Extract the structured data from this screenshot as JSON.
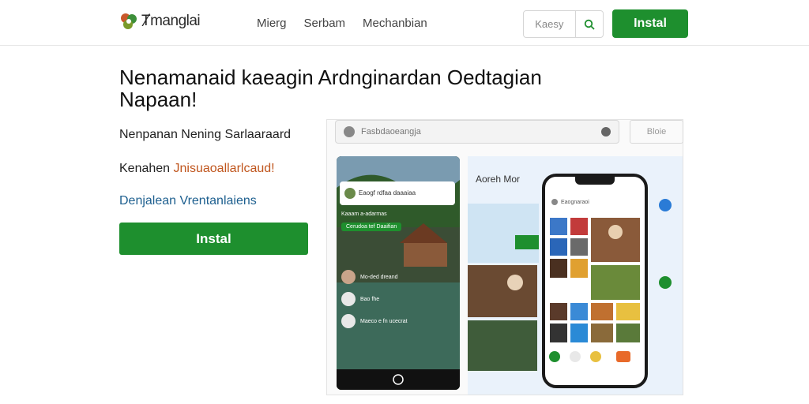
{
  "header": {
    "brand": "Ⱦmanglai",
    "nav": [
      "Mierg",
      "Serbam",
      "Mechanbian"
    ],
    "search_placeholder": "Kaesy",
    "install_label": "Instal"
  },
  "hero": {
    "headline": "Nenamanaid kaeagin Ardnginardan Oedtagian Napaan!",
    "features": {
      "f1": "Nenpanan Nening Sarlaaraard",
      "f2_prefix": "Kenahen ",
      "f2_highlight": "Jnisuaoallarlcaud!",
      "f3": "Denjalean Vrentanlaiens"
    },
    "install_label": "Instal"
  },
  "preview": {
    "search_text": "Fasbdaoeangja",
    "button_label": "Bloie",
    "phone1": {
      "card_title": "Eaogf rdfaa daaaiaa",
      "tag": "Kaaam a-adarmas",
      "pill": "Cerudoa tef Daaifian",
      "item1": "Mo-ded dreand",
      "item2": "Bao fhe",
      "item3": "Maeco e fn ucecrat"
    },
    "panel2": {
      "title": "Aoreh Mor",
      "phone_label": "Eaognaraoi"
    }
  },
  "colors": {
    "accent": "#1e8f2e",
    "highlight": "#c0561e",
    "link": "#1d5f8f"
  }
}
